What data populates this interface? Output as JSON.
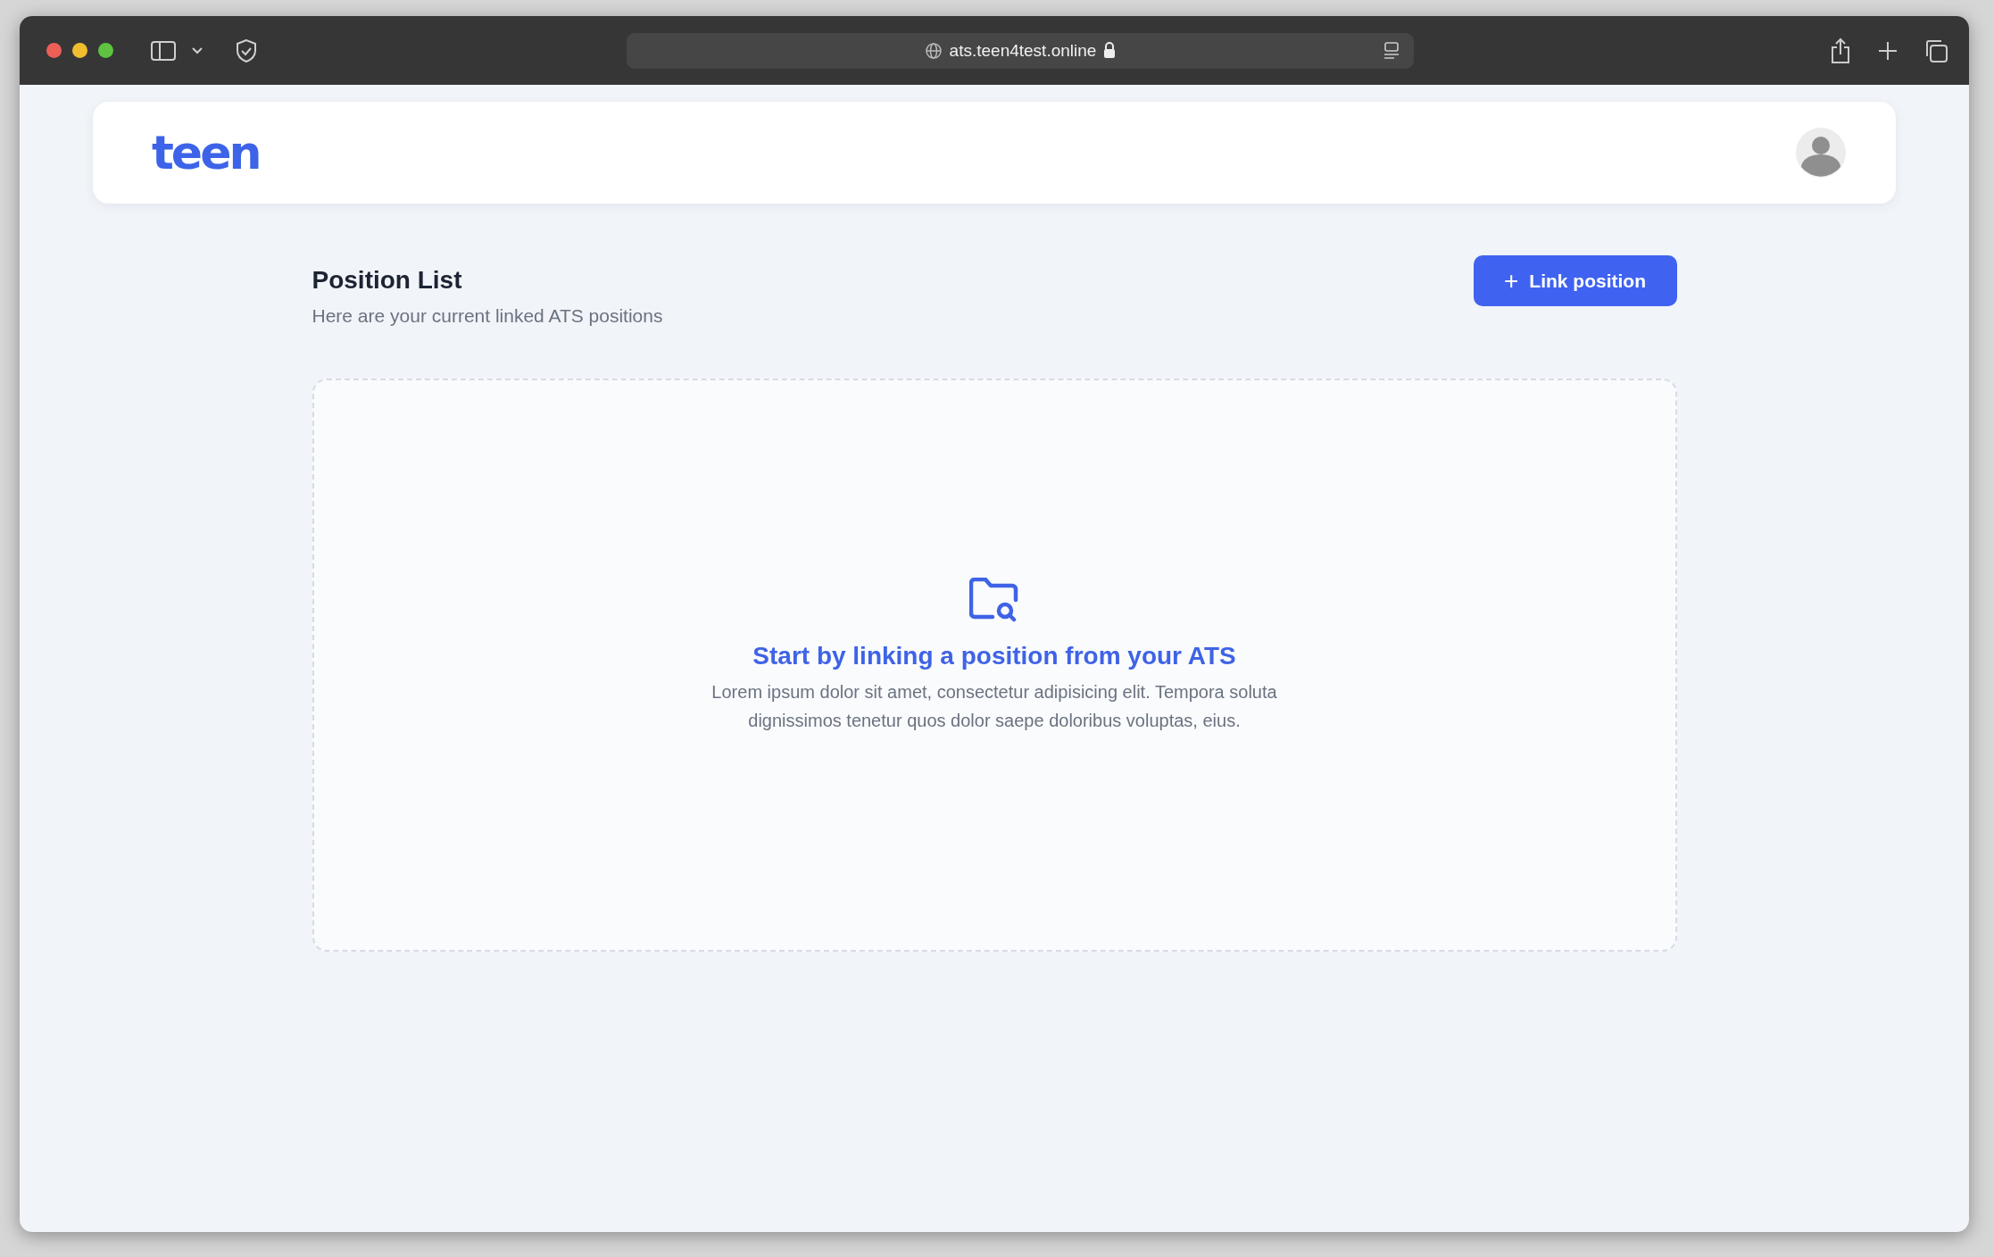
{
  "browser": {
    "url": "ats.teen4test.online"
  },
  "header": {
    "logo": "teen"
  },
  "page": {
    "title": "Position List",
    "subtitle": "Here are your current linked ATS positions",
    "button": {
      "icon": "+",
      "label": "Link position"
    }
  },
  "empty_state": {
    "title": "Start by linking a position from your ATS",
    "text": "Lorem ipsum dolor sit amet, consectetur adipisicing elit. Tempora soluta dignissimos tenetur quos dolor saepe doloribus voluptas, eius."
  }
}
